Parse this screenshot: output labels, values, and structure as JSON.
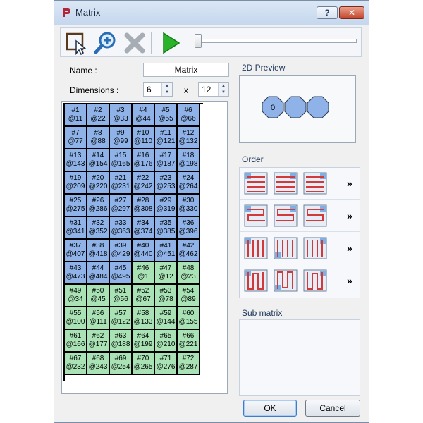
{
  "window": {
    "title": "Matrix",
    "help_label": "?",
    "close_label": "✕"
  },
  "form": {
    "name_label": "Name :",
    "name_value": "Matrix",
    "dimensions_label": "Dimensions :",
    "dim_x": "6",
    "dim_sep": "x",
    "dim_y": "12"
  },
  "grid": {
    "cells": [
      [
        "#1",
        "@11",
        "blue"
      ],
      [
        "#2",
        "@22",
        "blue"
      ],
      [
        "#3",
        "@33",
        "blue"
      ],
      [
        "#4",
        "@44",
        "blue"
      ],
      [
        "#5",
        "@55",
        "blue"
      ],
      [
        "#6",
        "@66",
        "blue"
      ],
      [
        "#7",
        "@77",
        "blue"
      ],
      [
        "#8",
        "@88",
        "blue"
      ],
      [
        "#9",
        "@99",
        "blue"
      ],
      [
        "#10",
        "@110",
        "blue"
      ],
      [
        "#11",
        "@121",
        "blue"
      ],
      [
        "#12",
        "@132",
        "blue"
      ],
      [
        "#13",
        "@143",
        "blue"
      ],
      [
        "#14",
        "@154",
        "blue"
      ],
      [
        "#15",
        "@165",
        "blue"
      ],
      [
        "#16",
        "@176",
        "blue"
      ],
      [
        "#17",
        "@187",
        "blue"
      ],
      [
        "#18",
        "@198",
        "blue"
      ],
      [
        "#19",
        "@209",
        "blue"
      ],
      [
        "#20",
        "@220",
        "blue"
      ],
      [
        "#21",
        "@231",
        "blue"
      ],
      [
        "#22",
        "@242",
        "blue"
      ],
      [
        "#23",
        "@253",
        "blue"
      ],
      [
        "#24",
        "@264",
        "blue"
      ],
      [
        "#25",
        "@275",
        "blue"
      ],
      [
        "#26",
        "@286",
        "blue"
      ],
      [
        "#27",
        "@297",
        "blue"
      ],
      [
        "#28",
        "@308",
        "blue"
      ],
      [
        "#29",
        "@319",
        "blue"
      ],
      [
        "#30",
        "@330",
        "blue"
      ],
      [
        "#31",
        "@341",
        "blue"
      ],
      [
        "#32",
        "@352",
        "blue"
      ],
      [
        "#33",
        "@363",
        "blue"
      ],
      [
        "#34",
        "@374",
        "blue"
      ],
      [
        "#35",
        "@385",
        "blue"
      ],
      [
        "#36",
        "@396",
        "blue"
      ],
      [
        "#37",
        "@407",
        "blue"
      ],
      [
        "#38",
        "@418",
        "blue"
      ],
      [
        "#39",
        "@429",
        "blue"
      ],
      [
        "#40",
        "@440",
        "blue"
      ],
      [
        "#41",
        "@451",
        "blue"
      ],
      [
        "#42",
        "@462",
        "blue"
      ],
      [
        "#43",
        "@473",
        "blue"
      ],
      [
        "#44",
        "@484",
        "blue"
      ],
      [
        "#45",
        "@495",
        "blue"
      ],
      [
        "#46",
        "@1",
        "green"
      ],
      [
        "#47",
        "@12",
        "green"
      ],
      [
        "#48",
        "@23",
        "green"
      ],
      [
        "#49",
        "@34",
        "green"
      ],
      [
        "#50",
        "@45",
        "green"
      ],
      [
        "#51",
        "@56",
        "green"
      ],
      [
        "#52",
        "@67",
        "green"
      ],
      [
        "#53",
        "@78",
        "green"
      ],
      [
        "#54",
        "@89",
        "green"
      ],
      [
        "#55",
        "@100",
        "green"
      ],
      [
        "#56",
        "@111",
        "green"
      ],
      [
        "#57",
        "@122",
        "green"
      ],
      [
        "#58",
        "@133",
        "green"
      ],
      [
        "#59",
        "@144",
        "green"
      ],
      [
        "#60",
        "@155",
        "green"
      ],
      [
        "#61",
        "@166",
        "green"
      ],
      [
        "#62",
        "@177",
        "green"
      ],
      [
        "#63",
        "@188",
        "green"
      ],
      [
        "#64",
        "@199",
        "green"
      ],
      [
        "#65",
        "@210",
        "green"
      ],
      [
        "#66",
        "@221",
        "green"
      ],
      [
        "#67",
        "@232",
        "green"
      ],
      [
        "#68",
        "@243",
        "green"
      ],
      [
        "#69",
        "@254",
        "green"
      ],
      [
        "#70",
        "@265",
        "green"
      ],
      [
        "#71",
        "@276",
        "green"
      ],
      [
        "#72",
        "@287",
        "green"
      ]
    ]
  },
  "preview": {
    "title": "2D Preview",
    "first_node_label": "0"
  },
  "order": {
    "title": "Order",
    "more_label": "»"
  },
  "submatrix": {
    "title": "Sub matrix"
  },
  "buttons": {
    "ok": "OK",
    "cancel": "Cancel"
  },
  "colors": {
    "cell_blue": "#8fb3e8",
    "cell_green": "#a9e3b5",
    "octagon_fill": "#8fb3e8",
    "play_green": "#29b32a",
    "path_red": "#d23a3a"
  },
  "icons": {
    "toolbar": [
      "select-icon",
      "zoom-icon",
      "delete-icon",
      "play-icon"
    ],
    "order": [
      "order-icon"
    ]
  }
}
